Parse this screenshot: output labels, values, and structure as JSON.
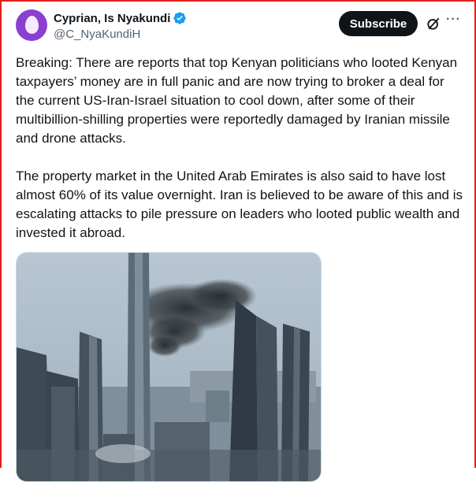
{
  "author": {
    "display_name": "Cyprian, Is Nyakundi",
    "handle": "@C_NyaKundiH",
    "verified": true
  },
  "actions": {
    "subscribe_label": "Subscribe",
    "grok_icon": "grok-icon",
    "more_icon": "more-icon"
  },
  "post": {
    "paragraph_1": "Breaking: There are reports that top Kenyan politicians who looted Kenyan taxpayers’ money are in full panic and are now trying to broker a deal for the current US-Iran-Israel situation to cool down, after some of their multibillion-shilling properties were reportedly damaged by Iranian missile and drone attacks.",
    "paragraph_2": "The property market in the United Arab Emirates is also said to have lost almost 60% of its value overnight. Iran is believed to be aware of this and is escalating attacks to pile pressure on leaders who looted public wealth and invested it abroad."
  },
  "colors": {
    "subscribe_bg": "#0f1419",
    "verified": "#1d9bf0",
    "avatar": "#8a3fd1",
    "frame": "#e0201b"
  }
}
